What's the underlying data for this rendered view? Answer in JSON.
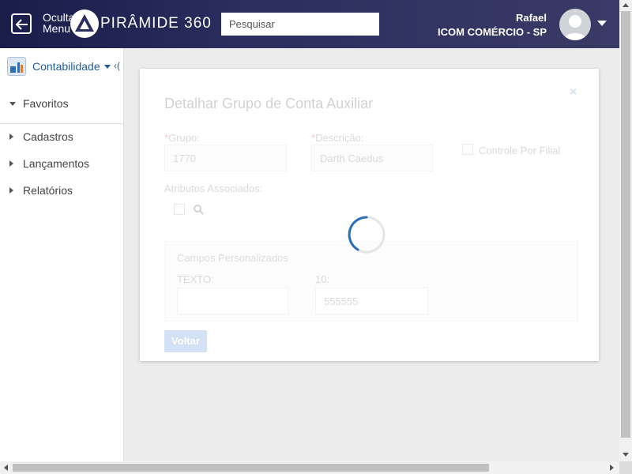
{
  "header": {
    "hide_menu_label": "Ocultar Menu",
    "logo_text": "PIRÂMIDE 360",
    "search_placeholder": "Pesquisar",
    "user_name": "Rafael",
    "user_company": "ICOM COMÉRCIO - SP"
  },
  "sidebar": {
    "module_label": "Contabilidade",
    "module_extra": "‹(",
    "items": [
      {
        "label": "Favoritos",
        "expanded": true
      },
      {
        "label": "Cadastros",
        "expanded": false
      },
      {
        "label": "Lançamentos",
        "expanded": false
      },
      {
        "label": "Relatórios",
        "expanded": false
      }
    ]
  },
  "modal": {
    "title": "Detalhar Grupo de Conta Auxiliar",
    "close_symbol": "×",
    "grupo_label": "Grupo:",
    "grupo_value": "1770",
    "descricao_label": "Descrição:",
    "descricao_value": "Darth Caedus",
    "controle_label": "Controle Por Filial",
    "atributos_label": "Atributos Associados:",
    "panel_title": "Campos Personalizados",
    "texto_label": "TEXTO:",
    "texto_value": "",
    "num_label": "10:",
    "num_value": "555555",
    "back_label": "Voltar",
    "required_mark": "*"
  },
  "colors": {
    "header_start": "#1a1d4a",
    "header_end": "#3a3a66",
    "accent": "#1f5c99",
    "button": "#3a7bd5"
  },
  "state": {
    "loading": true
  }
}
